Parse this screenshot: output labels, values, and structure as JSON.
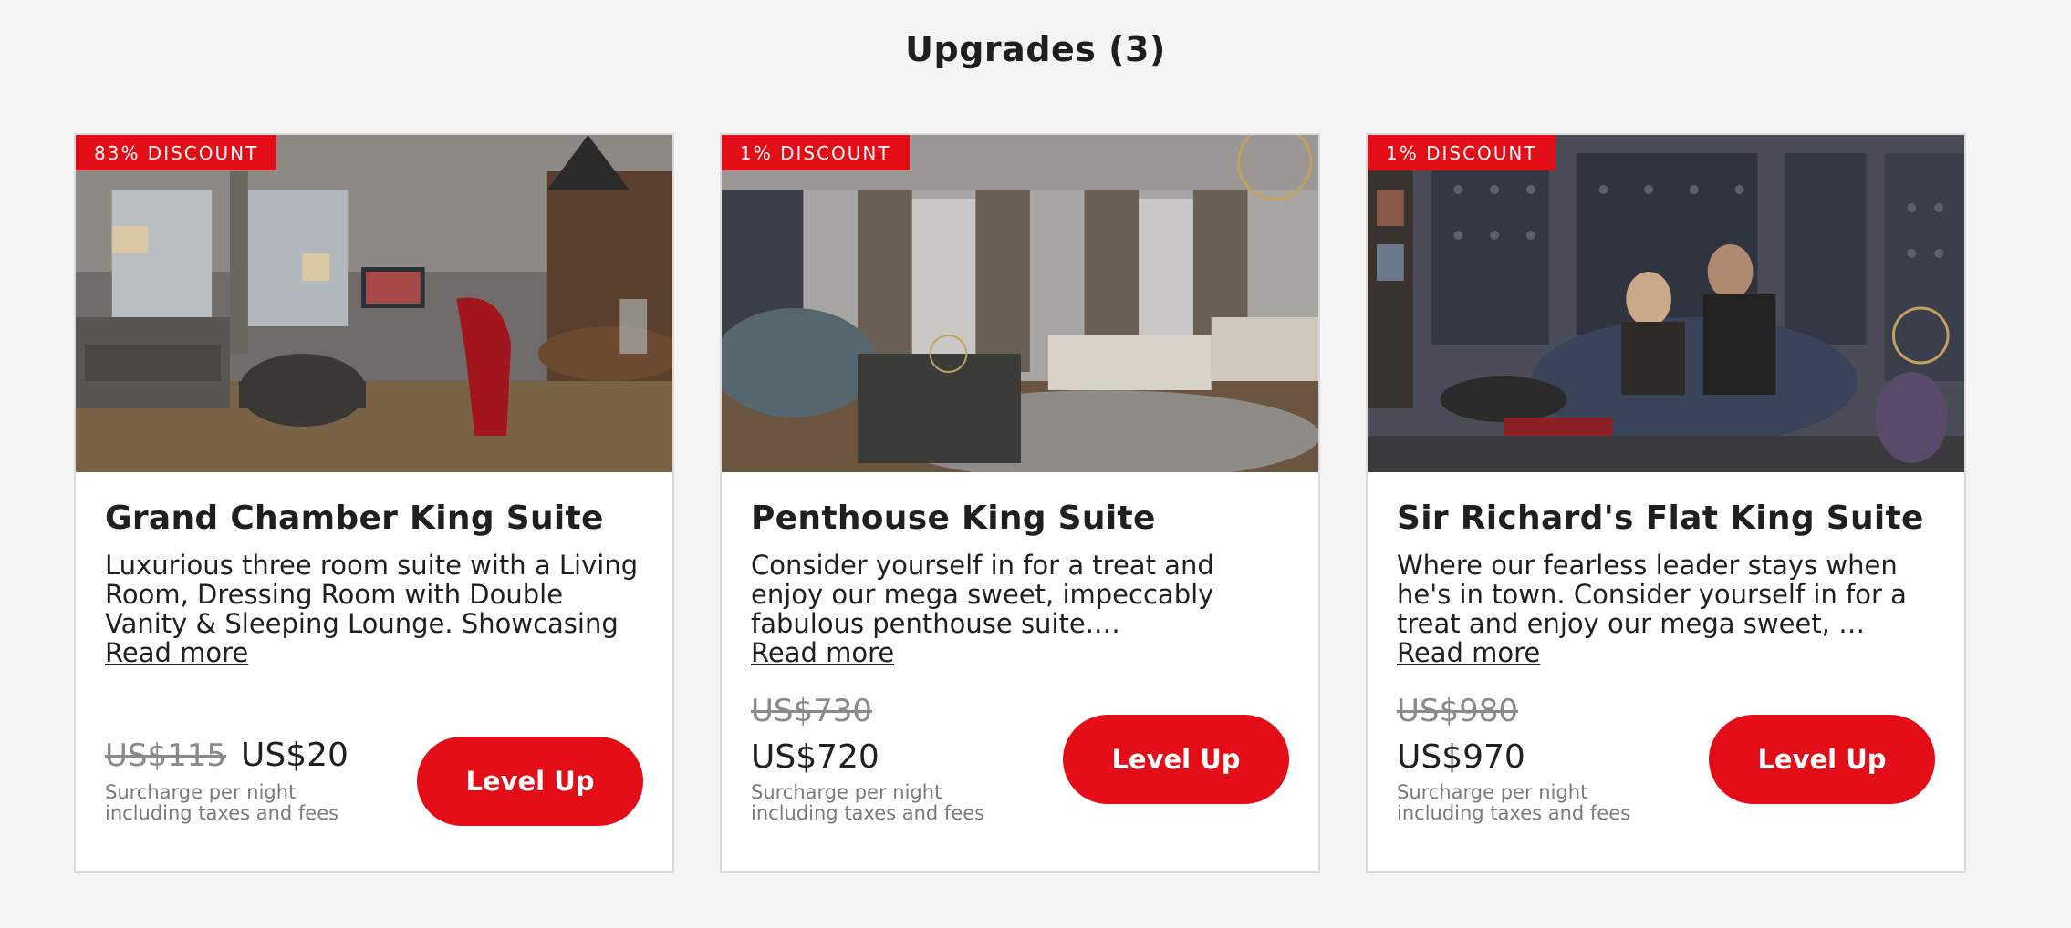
{
  "page": {
    "title": "Upgrades (3)"
  },
  "cards": [
    {
      "badge": "83% DISCOUNT",
      "image_icon": "room-photo-living-lounge",
      "title": "Grand Chamber King Suite",
      "description": "Luxurious three room suite with a Living Room, Dressing Room with Double Vanity & Sleeping Lounge. Showcasing …",
      "read_more": "Read more",
      "price_old": "US$115",
      "price_new": "US$20",
      "surcharge_line1": "Surcharge per night",
      "surcharge_line2": "including taxes and fees",
      "button": "Level Up"
    },
    {
      "badge": "1% DISCOUNT",
      "image_icon": "room-photo-penthouse-lounge",
      "title": "Penthouse King Suite",
      "description": "Consider yourself in for a treat and enjoy our mega sweet, impeccably fabulous penthouse suite.…",
      "read_more": "Read more",
      "price_old": "US$730",
      "price_new": "US$720",
      "surcharge_line1": "Surcharge per night",
      "surcharge_line2": "including taxes and fees",
      "button": "Level Up"
    },
    {
      "badge": "1% DISCOUNT",
      "image_icon": "room-photo-couple-on-sofa",
      "title": "Sir Richard's Flat King Suite",
      "description": "Where our fearless leader stays when he's in town. Consider yourself in for a treat and enjoy our mega sweet, …",
      "read_more": "Read more",
      "price_old": "US$980",
      "price_new": "US$970",
      "surcharge_line1": "Surcharge per night",
      "surcharge_line2": "including taxes and fees",
      "button": "Level Up"
    }
  ],
  "colors": {
    "accent": "#e20d17",
    "background": "#f5f5f5",
    "card_border": "#dadada",
    "muted_text": "#7a7a7a"
  }
}
